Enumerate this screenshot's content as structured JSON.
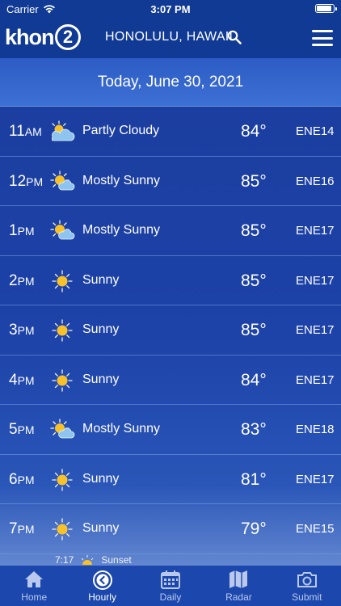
{
  "status_bar": {
    "carrier": "Carrier",
    "time": "3:07 PM"
  },
  "header": {
    "logo_text": "khon",
    "logo_number": "2",
    "location": "HONOLULU, HAWAII",
    "search_icon": "search-icon",
    "menu_icon": "hamburger-menu-icon"
  },
  "date_label": "Today, June 30, 2021",
  "hours": [
    {
      "hour": "11",
      "ampm": "AM",
      "icon": "partly-cloudy",
      "condition": "Partly Cloudy",
      "temp": "84°",
      "wind": "ENE14"
    },
    {
      "hour": "12",
      "ampm": "PM",
      "icon": "mostly-sunny",
      "condition": "Mostly Sunny",
      "temp": "85°",
      "wind": "ENE16"
    },
    {
      "hour": "1",
      "ampm": "PM",
      "icon": "mostly-sunny",
      "condition": "Mostly Sunny",
      "temp": "85°",
      "wind": "ENE17"
    },
    {
      "hour": "2",
      "ampm": "PM",
      "icon": "sunny",
      "condition": "Sunny",
      "temp": "85°",
      "wind": "ENE17"
    },
    {
      "hour": "3",
      "ampm": "PM",
      "icon": "sunny",
      "condition": "Sunny",
      "temp": "85°",
      "wind": "ENE17"
    },
    {
      "hour": "4",
      "ampm": "PM",
      "icon": "sunny",
      "condition": "Sunny",
      "temp": "84°",
      "wind": "ENE17"
    },
    {
      "hour": "5",
      "ampm": "PM",
      "icon": "mostly-sunny",
      "condition": "Mostly Sunny",
      "temp": "83°",
      "wind": "ENE18"
    },
    {
      "hour": "6",
      "ampm": "PM",
      "icon": "sunny",
      "condition": "Sunny",
      "temp": "81°",
      "wind": "ENE17"
    },
    {
      "hour": "7",
      "ampm": "PM",
      "icon": "sunny",
      "condition": "Sunny",
      "temp": "79°",
      "wind": "ENE15"
    }
  ],
  "sunset": {
    "time": "7:17",
    "label": "Sunset"
  },
  "tabs": [
    {
      "label": "Home",
      "icon": "home-icon",
      "active": false
    },
    {
      "label": "Hourly",
      "icon": "clock-icon",
      "active": true
    },
    {
      "label": "Daily",
      "icon": "calendar-icon",
      "active": false
    },
    {
      "label": "Radar",
      "icon": "map-icon",
      "active": false
    },
    {
      "label": "Submit",
      "icon": "camera-icon",
      "active": false
    }
  ],
  "colors": {
    "header_bg": "#103a94",
    "date_bar": "#3d70d4",
    "sun": "#f7c12b",
    "cloud": "#8fc4ef",
    "tab_bar": "#1c48ad"
  }
}
